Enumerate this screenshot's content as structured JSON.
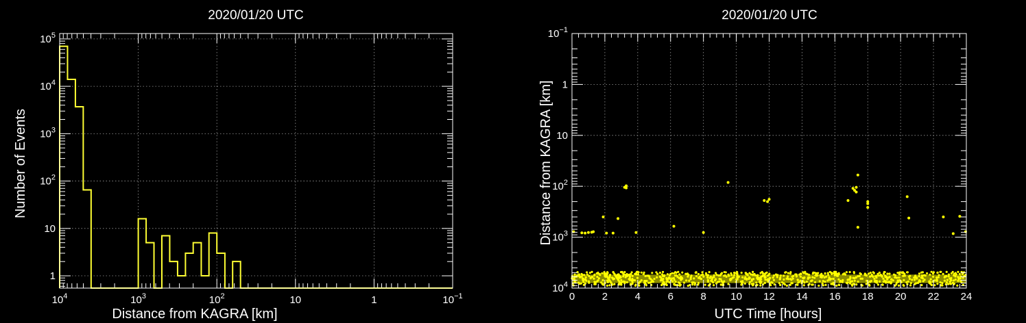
{
  "chart_data": [
    {
      "type": "histogram",
      "title": "2020/01/20 UTC",
      "xlabel": "Distance from KAGRA [km]",
      "ylabel": "Number of Events",
      "x_scale": "log",
      "x_reversed": true,
      "xlim": [
        10000,
        0.1
      ],
      "y_scale": "log",
      "ylim": [
        0.55,
        130000
      ],
      "x_tick_labels": [
        {
          "value": 10000,
          "base": "10",
          "exp": "4"
        },
        {
          "value": 1000,
          "base": "10",
          "exp": "3"
        },
        {
          "value": 100,
          "base": "10",
          "exp": "2"
        },
        {
          "value": 10,
          "base": "10",
          "exp": ""
        },
        {
          "value": 1,
          "base": "1",
          "exp": ""
        },
        {
          "value": 0.1,
          "base": "10",
          "exp": "−1"
        }
      ],
      "y_tick_labels": [
        {
          "value": 1,
          "base": "1",
          "exp": ""
        },
        {
          "value": 10,
          "base": "10",
          "exp": ""
        },
        {
          "value": 100,
          "base": "10",
          "exp": "2"
        },
        {
          "value": 1000,
          "base": "10",
          "exp": "3"
        },
        {
          "value": 10000,
          "base": "10",
          "exp": "4"
        },
        {
          "value": 100000,
          "base": "10",
          "exp": "5"
        }
      ],
      "grid": true,
      "color": "#ffff33",
      "bins": [
        {
          "x_hi": 10000,
          "x_lo": 7943,
          "count": 70000
        },
        {
          "x_hi": 7943,
          "x_lo": 6310,
          "count": 14000
        },
        {
          "x_hi": 6310,
          "x_lo": 5012,
          "count": 3700
        },
        {
          "x_hi": 5012,
          "x_lo": 3981,
          "count": 65
        },
        {
          "x_hi": 1000,
          "x_lo": 794,
          "count": 16
        },
        {
          "x_hi": 794,
          "x_lo": 631,
          "count": 5
        },
        {
          "x_hi": 501,
          "x_lo": 398,
          "count": 7
        },
        {
          "x_hi": 398,
          "x_lo": 316,
          "count": 2
        },
        {
          "x_hi": 316,
          "x_lo": 251,
          "count": 1
        },
        {
          "x_hi": 251,
          "x_lo": 200,
          "count": 3
        },
        {
          "x_hi": 200,
          "x_lo": 158,
          "count": 5
        },
        {
          "x_hi": 158,
          "x_lo": 126,
          "count": 1
        },
        {
          "x_hi": 126,
          "x_lo": 100,
          "count": 8
        },
        {
          "x_hi": 100,
          "x_lo": 79,
          "count": 3
        },
        {
          "x_hi": 63,
          "x_lo": 50,
          "count": 2
        }
      ]
    },
    {
      "type": "scatter",
      "title": "2020/01/20 UTC",
      "xlabel": "UTC Time [hours]",
      "ylabel": "Distance from KAGRA [km]",
      "xlim": [
        0,
        24
      ],
      "x_ticks": [
        0,
        2,
        4,
        6,
        8,
        10,
        12,
        14,
        16,
        18,
        20,
        22,
        24
      ],
      "y_scale": "log",
      "y_reversed": true,
      "ylim": [
        0.1,
        10000
      ],
      "y_tick_labels": [
        {
          "value": 0.1,
          "base": "10",
          "exp": "−1"
        },
        {
          "value": 1,
          "base": "1",
          "exp": ""
        },
        {
          "value": 10,
          "base": "10",
          "exp": ""
        },
        {
          "value": 100,
          "base": "10",
          "exp": "2"
        },
        {
          "value": 1000,
          "base": "10",
          "exp": "3"
        },
        {
          "value": 10000,
          "base": "10",
          "exp": "4"
        }
      ],
      "grid": true,
      "color": "#ffff00",
      "points": [
        [
          0.1,
          780
        ],
        [
          0.6,
          820
        ],
        [
          0.8,
          830
        ],
        [
          1.0,
          810
        ],
        [
          1.2,
          800
        ],
        [
          1.3,
          780
        ],
        [
          1.9,
          400
        ],
        [
          2.1,
          830
        ],
        [
          2.5,
          830
        ],
        [
          2.8,
          430
        ],
        [
          3.2,
          105
        ],
        [
          3.3,
          98
        ],
        [
          3.3,
          108
        ],
        [
          3.9,
          810
        ],
        [
          6.2,
          610
        ],
        [
          8.0,
          810
        ],
        [
          9.5,
          84
        ],
        [
          11.7,
          190
        ],
        [
          11.9,
          200
        ],
        [
          12.0,
          180
        ],
        [
          16.8,
          190
        ],
        [
          17.1,
          110
        ],
        [
          17.2,
          120
        ],
        [
          17.3,
          105
        ],
        [
          17.3,
          130
        ],
        [
          17.4,
          60
        ],
        [
          17.4,
          640
        ],
        [
          18.0,
          220
        ],
        [
          18.0,
          200
        ],
        [
          18.0,
          260
        ],
        [
          20.4,
          160
        ],
        [
          20.5,
          420
        ],
        [
          22.6,
          400
        ],
        [
          23.2,
          850
        ],
        [
          23.6,
          390
        ],
        [
          24.0,
          780
        ]
      ],
      "dense_band": {
        "x_range": [
          0,
          24
        ],
        "y_range": [
          4800,
          9000
        ]
      }
    }
  ]
}
